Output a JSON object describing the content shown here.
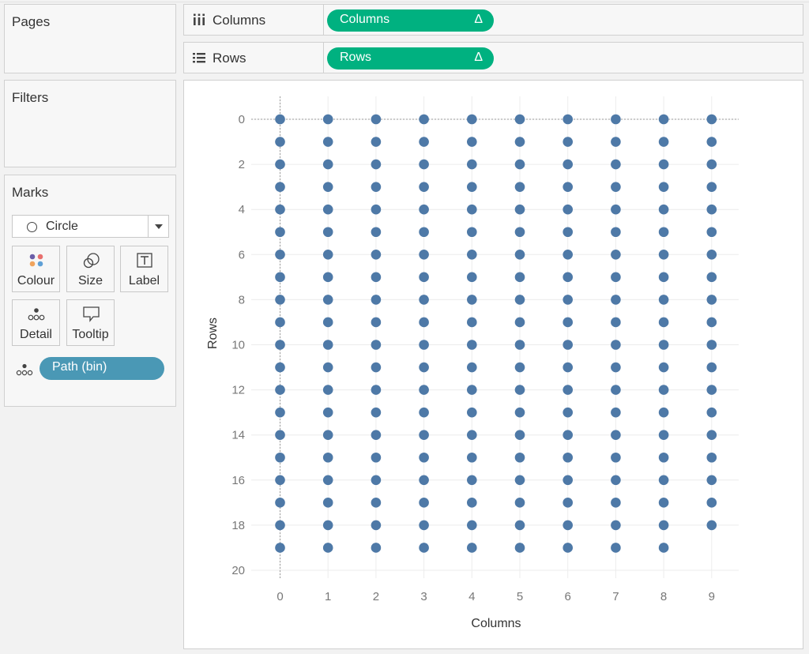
{
  "pages_card": {
    "title": "Pages"
  },
  "filters_card": {
    "title": "Filters"
  },
  "marks_card": {
    "title": "Marks",
    "mark_type": "Circle",
    "buttons": {
      "colour": "Colour",
      "size": "Size",
      "label": "Label",
      "detail": "Detail",
      "tooltip": "Tooltip"
    },
    "detail_pill": {
      "label": "Path (bin)",
      "color": "#4a98b5"
    }
  },
  "columns_shelf": {
    "label": "Columns",
    "pill": {
      "label": "Columns",
      "delta": "Δ",
      "color": "#00b180"
    }
  },
  "rows_shelf": {
    "label": "Rows",
    "pill": {
      "label": "Rows",
      "delta": "Δ",
      "color": "#00b180"
    }
  },
  "chart_data": {
    "type": "scatter",
    "xlabel": "Columns",
    "ylabel": "Rows",
    "xlim": [
      -0.5,
      9.5
    ],
    "ylim": [
      -0.5,
      20
    ],
    "y_reversed": true,
    "x_ticks": [
      "0",
      "1",
      "2",
      "3",
      "4",
      "5",
      "6",
      "7",
      "8",
      "9"
    ],
    "y_ticks": [
      "0",
      "2",
      "4",
      "6",
      "8",
      "10",
      "12",
      "14",
      "16",
      "18",
      "20"
    ],
    "mark_color": "#4e79a7",
    "points": {
      "columns": [
        0,
        1,
        2,
        3,
        4,
        5,
        6,
        7,
        8,
        9
      ],
      "rows_per_column": [
        [
          0,
          1,
          2,
          3,
          4,
          5,
          6,
          7,
          8,
          9,
          10,
          11,
          12,
          13,
          14,
          15,
          16,
          17,
          18,
          19
        ],
        [
          0,
          1,
          2,
          3,
          4,
          5,
          6,
          7,
          8,
          9,
          10,
          11,
          12,
          13,
          14,
          15,
          16,
          17,
          18,
          19
        ],
        [
          0,
          1,
          2,
          3,
          4,
          5,
          6,
          7,
          8,
          9,
          10,
          11,
          12,
          13,
          14,
          15,
          16,
          17,
          18,
          19
        ],
        [
          0,
          1,
          2,
          3,
          4,
          5,
          6,
          7,
          8,
          9,
          10,
          11,
          12,
          13,
          14,
          15,
          16,
          17,
          18,
          19
        ],
        [
          0,
          1,
          2,
          3,
          4,
          5,
          6,
          7,
          8,
          9,
          10,
          11,
          12,
          13,
          14,
          15,
          16,
          17,
          18,
          19
        ],
        [
          0,
          1,
          2,
          3,
          4,
          5,
          6,
          7,
          8,
          9,
          10,
          11,
          12,
          13,
          14,
          15,
          16,
          17,
          18,
          19
        ],
        [
          0,
          1,
          2,
          3,
          4,
          5,
          6,
          7,
          8,
          9,
          10,
          11,
          12,
          13,
          14,
          15,
          16,
          17,
          18,
          19
        ],
        [
          0,
          1,
          2,
          3,
          4,
          5,
          6,
          7,
          8,
          9,
          10,
          11,
          12,
          13,
          14,
          15,
          16,
          17,
          18,
          19
        ],
        [
          0,
          1,
          2,
          3,
          4,
          5,
          6,
          7,
          8,
          9,
          10,
          11,
          12,
          13,
          14,
          15,
          16,
          17,
          18,
          19
        ],
        [
          0,
          1,
          2,
          3,
          4,
          5,
          6,
          7,
          8,
          9,
          10,
          11,
          12,
          13,
          14,
          15,
          16,
          17,
          18
        ]
      ]
    }
  }
}
